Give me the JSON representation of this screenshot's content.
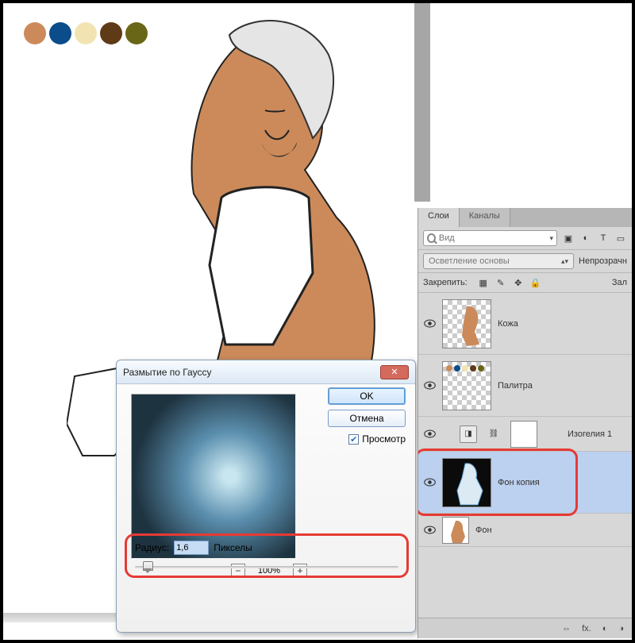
{
  "palette": [
    "#cc8a5a",
    "#0b4c8b",
    "#f2e4b2",
    "#5e3a16",
    "#6a6617"
  ],
  "dialog": {
    "title": "Размытие по Гауссу",
    "ok": "OK",
    "cancel": "Отмена",
    "preview": "Просмотр",
    "preview_checked": true,
    "zoom": "100%",
    "radius_label": "Радиус:",
    "radius_value": "1,6",
    "radius_unit": "Пикселы"
  },
  "panel": {
    "tabs": {
      "layers": "Слои",
      "channels": "Каналы"
    },
    "search_placeholder": "Вид",
    "blend_mode": "Осветление основы",
    "opacity_label": "Непрозрачн",
    "lock_label": "Закрепить:",
    "fill_label": "Зал",
    "layers": [
      {
        "name": "Кожа"
      },
      {
        "name": "Палитра"
      },
      {
        "adjust_name": "Изогелия 1"
      },
      {
        "name": "Фон копия",
        "selected": true
      },
      {
        "name": "Фон"
      }
    ],
    "footer_fx": "fx."
  }
}
